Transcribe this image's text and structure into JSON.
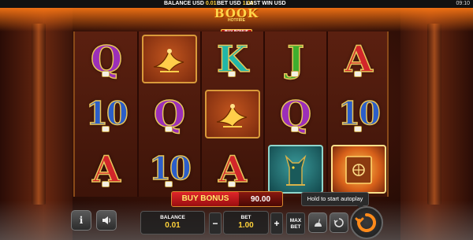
{
  "status_bar": {
    "balance_label": "BALANCE USD",
    "balance_value": "0.01",
    "bet_label": "BET USD",
    "bet_value": "1.00",
    "last_win_label": "LAST WIN USD",
    "clock": "09:10"
  },
  "logo": {
    "title": "BOOK",
    "subtitle": "HOTFIRE",
    "buy_tag": "BUY BONUS"
  },
  "reels": [
    [
      "Q",
      "10",
      "A"
    ],
    [
      "phoenix",
      "Q",
      "10"
    ],
    [
      "K",
      "phoenix",
      "A"
    ],
    [
      "J",
      "Q",
      "anubis"
    ],
    [
      "A",
      "10",
      "book"
    ]
  ],
  "symbol_icons": {
    "phoenix": "phoenix-icon",
    "anubis": "anubis-icon",
    "book": "book-scatter-icon"
  },
  "buy_bonus": {
    "label": "BUY BONUS",
    "price": "90.00"
  },
  "tooltip": "Hold to start autoplay",
  "controls": {
    "balance_label": "BALANCE",
    "balance_value": "0.01",
    "bet_label": "BET",
    "bet_value": "1.00",
    "minus": "−",
    "plus": "+",
    "max_bet_line1": "MAX",
    "max_bet_line2": "BET",
    "info": "i"
  },
  "colors": {
    "accent_yellow": "#ffd23a",
    "buy_red": "#e0262a",
    "spin_orange": "#ff8a1a"
  }
}
